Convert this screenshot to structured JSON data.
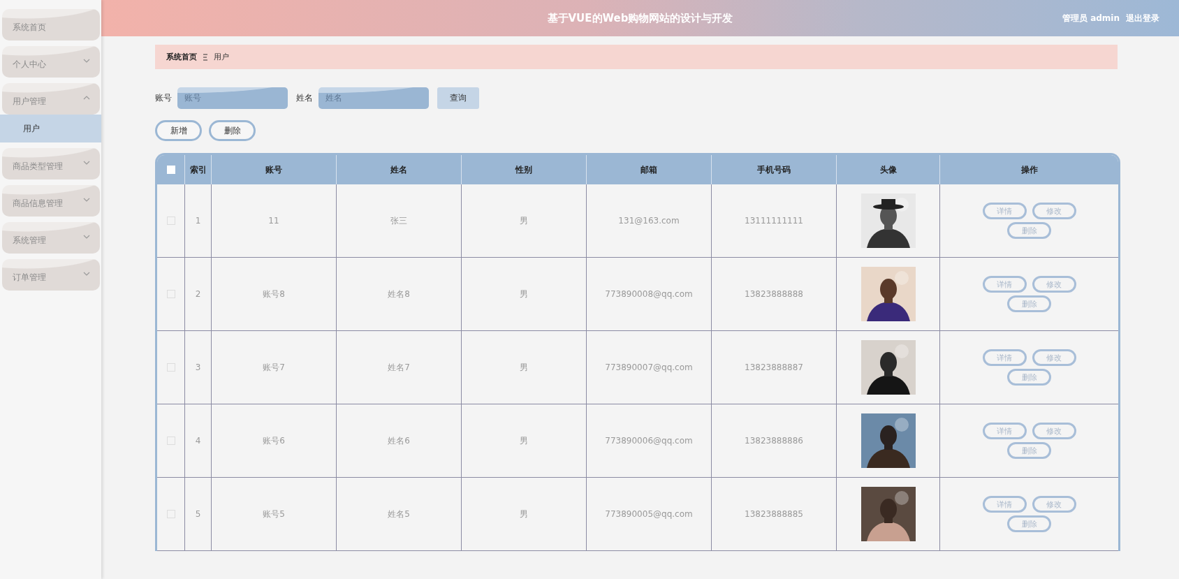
{
  "header": {
    "title": "基于VUE的Web购物网站的设计与开发",
    "user_label": "管理员 admin",
    "logout": "退出登录"
  },
  "sidebar": {
    "items": [
      {
        "label": "系统首页"
      },
      {
        "label": "个人中心",
        "expanded": false
      },
      {
        "label": "用户管理",
        "expanded": true,
        "children": [
          {
            "label": "用户",
            "selected": true
          }
        ]
      },
      {
        "label": "商品类型管理",
        "expanded": false
      },
      {
        "label": "商品信息管理",
        "expanded": false
      },
      {
        "label": "系统管理",
        "expanded": false
      },
      {
        "label": "订单管理",
        "expanded": false
      }
    ]
  },
  "breadcrumb": [
    {
      "label": "系统首页"
    },
    {
      "label": "用户"
    }
  ],
  "search": {
    "fields": [
      {
        "label": "账号",
        "placeholder": "账号"
      },
      {
        "label": "姓名",
        "placeholder": "姓名"
      }
    ],
    "button": "查询"
  },
  "actions": [
    "新增",
    "删除"
  ],
  "table": {
    "select_all": {
      "checked": false
    },
    "columns": [
      "索引",
      "账号",
      "姓名",
      "性别",
      "邮箱",
      "手机号码",
      "头像",
      "操作"
    ],
    "rows": [
      {
        "checked": false,
        "index": "1",
        "account": "11",
        "name": "张三",
        "gender": "男",
        "email": "131@163.com",
        "phone": "13111111111",
        "actions": [
          "详情",
          "修改",
          "删除"
        ]
      },
      {
        "checked": false,
        "index": "2",
        "account": "账号8",
        "name": "姓名8",
        "gender": "男",
        "email": "773890008@qq.com",
        "phone": "13823888888",
        "actions": [
          "详情",
          "修改",
          "删除"
        ]
      },
      {
        "checked": false,
        "index": "3",
        "account": "账号7",
        "name": "姓名7",
        "gender": "男",
        "email": "773890007@qq.com",
        "phone": "13823888887",
        "actions": [
          "详情",
          "修改",
          "删除"
        ]
      },
      {
        "checked": false,
        "index": "4",
        "account": "账号6",
        "name": "姓名6",
        "gender": "男",
        "email": "773890006@qq.com",
        "phone": "13823888886",
        "actions": [
          "详情",
          "修改",
          "删除"
        ]
      },
      {
        "checked": false,
        "index": "5",
        "account": "账号5",
        "name": "姓名5",
        "gender": "男",
        "email": "773890005@qq.com",
        "phone": "13823888885",
        "actions": [
          "详情",
          "修改",
          "删除"
        ]
      }
    ]
  }
}
